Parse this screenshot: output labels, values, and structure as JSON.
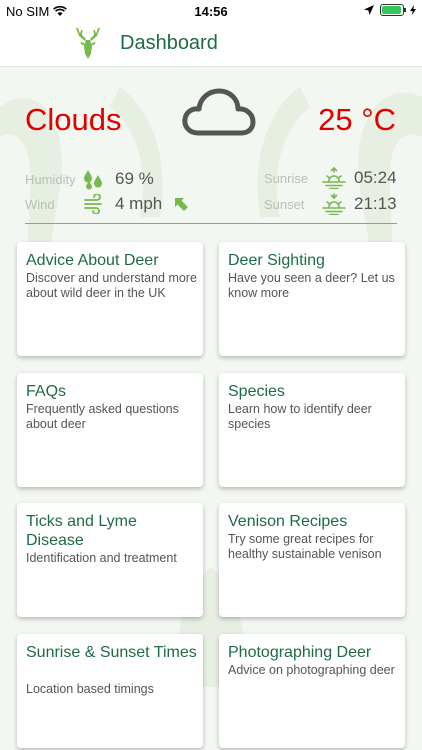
{
  "status_bar": {
    "carrier": "No SIM",
    "time": "14:56"
  },
  "nav": {
    "title": "Dashboard"
  },
  "weather": {
    "condition": "Clouds",
    "temperature": "25 °C",
    "humidity_label": "Humidity",
    "humidity_value": "69 %",
    "wind_label": "Wind",
    "wind_value": "4 mph",
    "sunrise_label": "Sunrise",
    "sunrise_value": "05:24",
    "sunset_label": "Sunset",
    "sunset_value": "21:13"
  },
  "cards": [
    {
      "title": "Advice About Deer",
      "description": "Discover and understand more about wild deer in the UK"
    },
    {
      "title": "Deer Sighting",
      "description": "Have you seen a deer? Let us know more"
    },
    {
      "title": "FAQs",
      "description": "Frequently asked questions about deer"
    },
    {
      "title": "Species",
      "description": "Learn how to identify deer species"
    },
    {
      "title": "Ticks and Lyme Disease",
      "description": "Identification and treatment"
    },
    {
      "title": "Venison Recipes",
      "description": "Try some great recipes for healthy sustainable venison"
    },
    {
      "title": "Sunrise & Sunset Times",
      "description": "Location based timings"
    },
    {
      "title": "Photographing Deer",
      "description": "Advice on photographing deer"
    }
  ],
  "colors": {
    "accent": "#1f6b45",
    "icon_green": "#77b84f",
    "alert_red": "#e00000"
  }
}
